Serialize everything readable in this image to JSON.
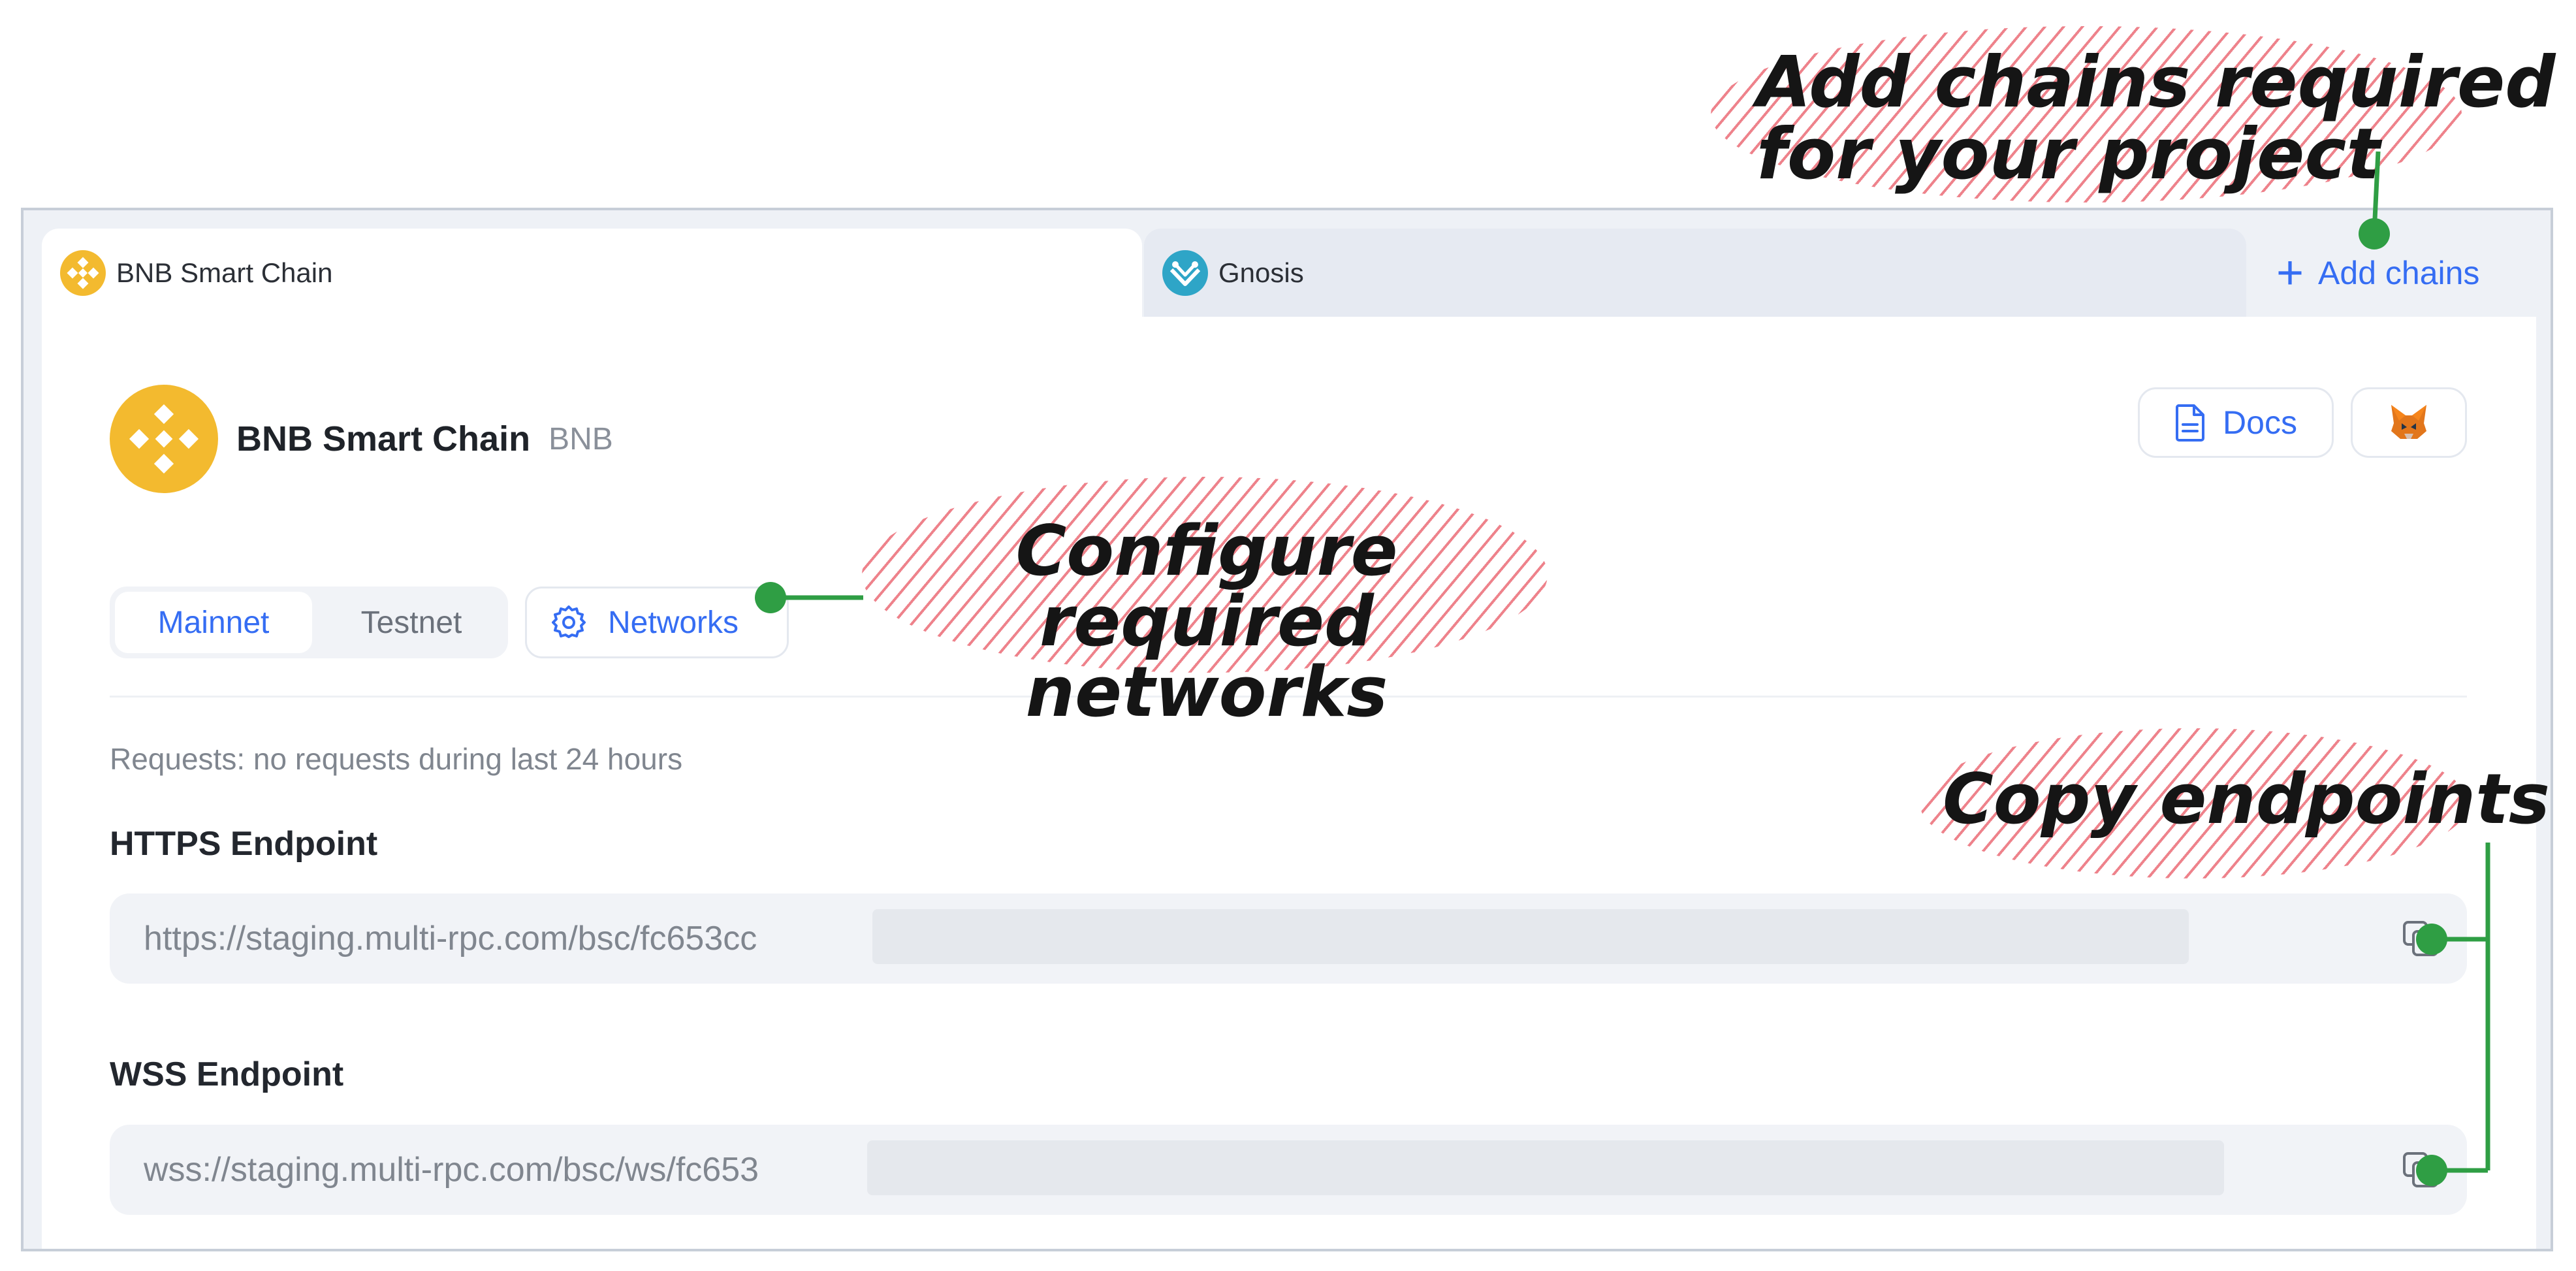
{
  "tabs": [
    {
      "label": "BNB Smart Chain",
      "icon": "bnb-logo-icon",
      "active": true
    },
    {
      "label": "Gnosis",
      "icon": "gnosis-logo-icon",
      "active": false
    }
  ],
  "add_chains": {
    "label": "Add chains",
    "icon": "plus-icon"
  },
  "chain": {
    "name": "BNB Smart Chain",
    "symbol": "BNB",
    "icon": "bnb-logo-icon"
  },
  "actions": {
    "docs_label": "Docs",
    "docs_icon": "document-icon",
    "wallet_icon": "metamask-fox-icon"
  },
  "network_toggle": {
    "options": [
      "Mainnet",
      "Testnet"
    ],
    "selected": "Mainnet"
  },
  "networks_button": {
    "label": "Networks",
    "icon": "gear-icon"
  },
  "requests_text": "Requests: no requests during last 24 hours",
  "endpoints": [
    {
      "label": "HTTPS Endpoint",
      "value": "https://staging.multi-rpc.com/bsc/fc653cc",
      "copy_icon": "copy-icon"
    },
    {
      "label": "WSS Endpoint",
      "value": "wss://staging.multi-rpc.com/bsc/ws/fc653",
      "copy_icon": "copy-icon"
    }
  ],
  "annotations": {
    "add_chains": [
      "Add chains required",
      "for your project"
    ],
    "configure": [
      "Configure required",
      "networks"
    ],
    "copy": "Copy endpoints"
  },
  "colors": {
    "accent": "#356df3",
    "bnb_yellow": "#f3ba2f",
    "annotation_line": "#2f9e44",
    "annotation_hatch": "#e85864"
  }
}
